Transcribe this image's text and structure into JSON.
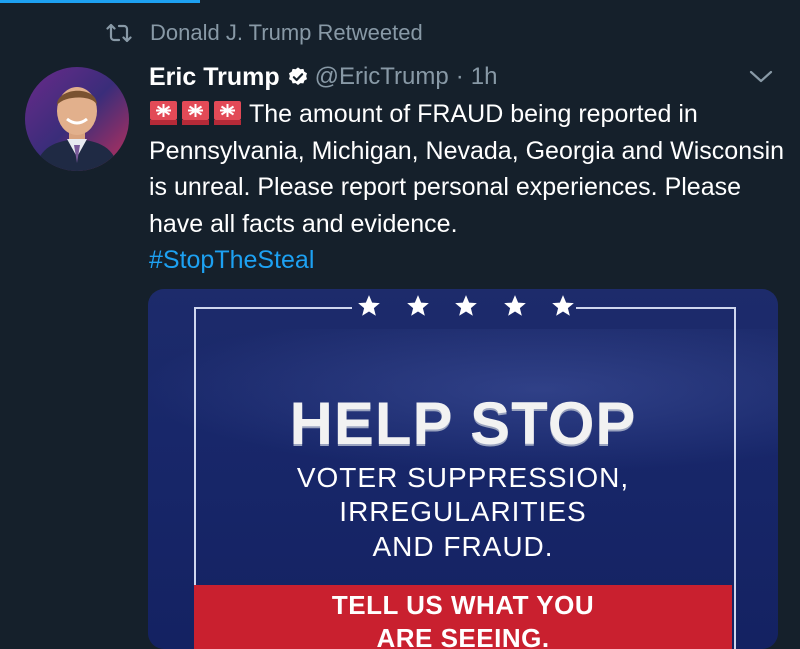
{
  "retweet": {
    "label": "Donald J. Trump Retweeted",
    "icon": "retweet-icon"
  },
  "author": {
    "display_name": "Eric Trump",
    "handle": "@EricTrump",
    "separator": "·",
    "time": "1h",
    "verified": true
  },
  "tweet": {
    "emoji": [
      "rotating-light-icon",
      "rotating-light-icon",
      "rotating-light-icon"
    ],
    "text": "The amount of FRAUD being reported in Pennsylvania, Michigan, Nevada, Georgia and Wisconsin is unreal. Please report personal experiences. Please have all facts and evidence.",
    "hashtag": "#StopTheSteal"
  },
  "media": {
    "stars": [
      "★",
      "★",
      "★",
      "★",
      "★"
    ],
    "headline": "HELP STOP",
    "lines": [
      "VOTER SUPPRESSION,",
      "IRREGULARITIES",
      "AND FRAUD."
    ],
    "band_line1": "TELL US WHAT YOU",
    "band_line2": "ARE SEEING."
  },
  "colors": {
    "background": "#15202b",
    "accent": "#1da1f2",
    "muted": "#8899a6",
    "band_red": "#c9202f",
    "card_blue": "#1b2a6a"
  }
}
